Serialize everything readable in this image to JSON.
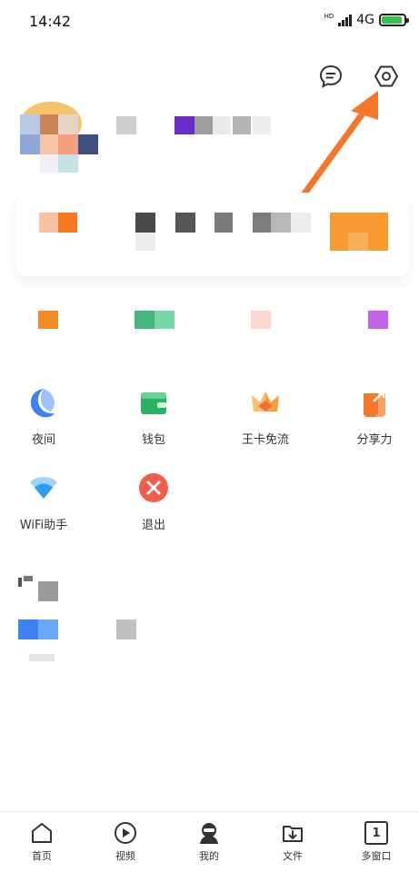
{
  "status_bar": {
    "time": "14:42",
    "network": "4G",
    "network_sub": "HD",
    "icons": [
      "signal-icon",
      "battery-charging-icon"
    ]
  },
  "header": {
    "icons": [
      "message-icon",
      "settings-icon"
    ]
  },
  "grid": {
    "row1": [
      {
        "label": "夜间",
        "icon": "night-mode-icon"
      },
      {
        "label": "钱包",
        "icon": "wallet-icon"
      },
      {
        "label": "王卡免流",
        "icon": "crown-icon"
      },
      {
        "label": "分享力",
        "icon": "share-icon"
      }
    ],
    "row2": [
      {
        "label": "WiFi助手",
        "icon": "wifi-icon"
      },
      {
        "label": "退出",
        "icon": "exit-icon"
      }
    ]
  },
  "bottom_nav": [
    {
      "label": "首页",
      "icon": "home-icon"
    },
    {
      "label": "视频",
      "icon": "video-icon"
    },
    {
      "label": "我的",
      "icon": "profile-icon"
    },
    {
      "label": "文件",
      "icon": "file-download-icon"
    },
    {
      "label": "多窗口",
      "icon": "multi-window-icon",
      "badge": "1"
    }
  ],
  "colors": {
    "arrow": "#f5772a",
    "night": "#3d82f0",
    "wallet": "#27b35f",
    "crown": "#f5a13a",
    "share": "#f5772a",
    "wifi": "#2e9bf0",
    "exit": "#f25c4a"
  }
}
